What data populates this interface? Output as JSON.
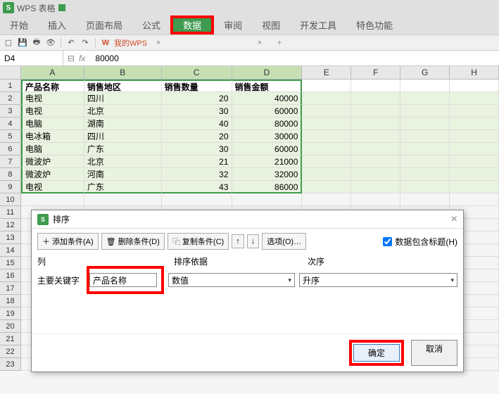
{
  "app": {
    "logo": "S",
    "title": "WPS 表格"
  },
  "menu": [
    "开始",
    "插入",
    "页面布局",
    "公式",
    "数据",
    "审阅",
    "视图",
    "开发工具",
    "特色功能"
  ],
  "menu_active": 4,
  "wps_tab": "我的WPS",
  "formula": {
    "cell_ref": "D4",
    "value": "80000"
  },
  "columns": [
    "A",
    "B",
    "C",
    "D",
    "E",
    "F",
    "G",
    "H"
  ],
  "headers": [
    "产品名称",
    "销售地区",
    "销售数量",
    "销售金额"
  ],
  "rows": [
    [
      "电视",
      "四川",
      "20",
      "40000"
    ],
    [
      "电视",
      "北京",
      "30",
      "60000"
    ],
    [
      "电脑",
      "湖南",
      "40",
      "80000"
    ],
    [
      "电冰箱",
      "四川",
      "20",
      "30000"
    ],
    [
      "电脑",
      "广东",
      "30",
      "60000"
    ],
    [
      "微波炉",
      "北京",
      "21",
      "21000"
    ],
    [
      "微波炉",
      "河南",
      "32",
      "32000"
    ],
    [
      "电视",
      "广东",
      "43",
      "86000"
    ]
  ],
  "dialog": {
    "title": "排序",
    "add": "添加条件(A)",
    "del": "删除条件(D)",
    "copy": "复制条件(C)",
    "opts": "选项(O)…",
    "checkbox": "数据包含标题(H)",
    "col_h": "列",
    "sort_by_h": "排序依据",
    "order_h": "次序",
    "key_label": "主要关键字",
    "key_value": "产品名称",
    "sort_by": "数值",
    "order": "升序",
    "ok": "确定",
    "cancel": "取消"
  },
  "chart_data": {
    "type": "table",
    "title": "",
    "columns": [
      "产品名称",
      "销售地区",
      "销售数量",
      "销售金额"
    ],
    "rows": [
      [
        "电视",
        "四川",
        20,
        40000
      ],
      [
        "电视",
        "北京",
        30,
        60000
      ],
      [
        "电脑",
        "湖南",
        40,
        80000
      ],
      [
        "电冰箱",
        "四川",
        20,
        30000
      ],
      [
        "电脑",
        "广东",
        30,
        60000
      ],
      [
        "微波炉",
        "北京",
        21,
        21000
      ],
      [
        "微波炉",
        "河南",
        32,
        32000
      ],
      [
        "电视",
        "广东",
        43,
        86000
      ]
    ]
  }
}
